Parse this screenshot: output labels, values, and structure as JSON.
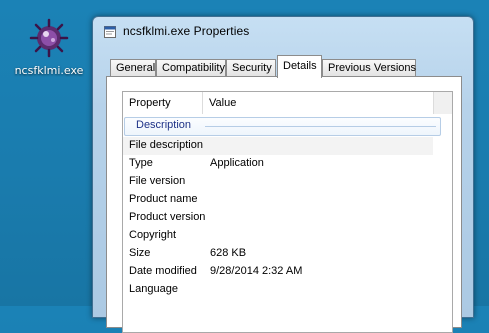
{
  "desktop": {
    "icon_label": "ncsfklmi.exe",
    "icon_name": "exe-bug-icon"
  },
  "window": {
    "title": "ncsfklmi.exe Properties",
    "title_icon": "exe-icon",
    "tabs": [
      {
        "label": "General",
        "active": false
      },
      {
        "label": "Compatibility",
        "active": false
      },
      {
        "label": "Security",
        "active": false
      },
      {
        "label": "Details",
        "active": true
      },
      {
        "label": "Previous Versions",
        "active": false
      }
    ]
  },
  "details": {
    "columns": {
      "property": "Property",
      "value": "Value"
    },
    "group": "Description",
    "rows": [
      {
        "property": "File description",
        "value": ""
      },
      {
        "property": "Type",
        "value": "Application"
      },
      {
        "property": "File version",
        "value": ""
      },
      {
        "property": "Product name",
        "value": ""
      },
      {
        "property": "Product version",
        "value": ""
      },
      {
        "property": "Copyright",
        "value": ""
      },
      {
        "property": "Size",
        "value": "628 KB"
      },
      {
        "property": "Date modified",
        "value": "9/28/2014 2:32 AM"
      },
      {
        "property": "Language",
        "value": ""
      }
    ]
  },
  "colors": {
    "desktop": "#1a7cae",
    "group_text": "#1e3287"
  }
}
